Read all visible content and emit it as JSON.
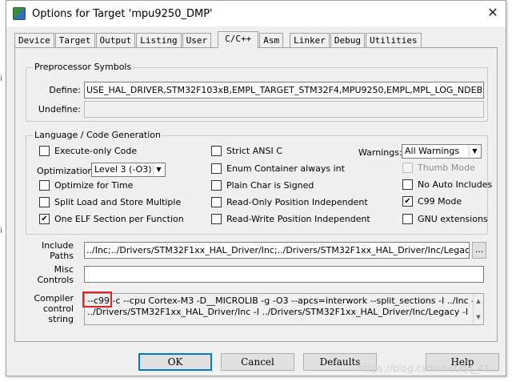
{
  "window": {
    "title": "Options for Target 'mpu9250_DMP'",
    "close_glyph": "✕"
  },
  "tabs": [
    "Device",
    "Target",
    "Output",
    "Listing",
    "User",
    "C/C++",
    "Asm",
    "Linker",
    "Debug",
    "Utilities"
  ],
  "active_tab": "C/C++",
  "preprocessor": {
    "legend": "Preprocessor Symbols",
    "define_label": "Define:",
    "define_value": "USE_HAL_DRIVER,STM32F103xB,EMPL_TARGET_STM32F4,MPU9250,EMPL,MPL_LOG_NDEBUG=",
    "undefine_label": "Undefine:",
    "undefine_value": ""
  },
  "language": {
    "legend": "Language / Code Generation",
    "execute_only": {
      "label": "Execute-only Code",
      "checked": false
    },
    "optimization_label": "Optimization:",
    "optimization_value": "Level 3 (-O3)",
    "optimize_time": {
      "label": "Optimize for Time",
      "checked": false
    },
    "split_load": {
      "label": "Split Load and Store Multiple",
      "checked": false
    },
    "one_elf": {
      "label": "One ELF Section per Function",
      "checked": true
    },
    "strict_ansi": {
      "label": "Strict ANSI C",
      "checked": false
    },
    "enum_container": {
      "label": "Enum Container always int",
      "checked": false
    },
    "plain_char": {
      "label": "Plain Char is Signed",
      "checked": false
    },
    "ro_pos": {
      "label": "Read-Only Position Independent",
      "checked": false
    },
    "rw_pos": {
      "label": "Read-Write Position Independent",
      "checked": false
    },
    "warnings_label": "Warnings:",
    "warnings_value": "All Warnings",
    "thumb_mode": {
      "label": "Thumb Mode",
      "checked": false
    },
    "no_auto_includes": {
      "label": "No Auto Includes",
      "checked": false
    },
    "c99_mode": {
      "label": "C99 Mode",
      "checked": true
    },
    "gnu_extensions": {
      "label": "GNU extensions",
      "checked": false
    }
  },
  "include": {
    "label_line1": "Include",
    "label_line2": "Paths",
    "value": "../Inc;../Drivers/STM32F1xx_HAL_Driver/Inc;../Drivers/STM32F1xx_HAL_Driver/Inc/Legacy;../Driv",
    "browse_label": "..."
  },
  "misc": {
    "label_line1": "Misc",
    "label_line2": "Controls",
    "value": ""
  },
  "compiler": {
    "label_line1": "Compiler",
    "label_line2": "control",
    "label_line3": "string",
    "line1": "--c99 -c --cpu Cortex-M3 -D__MICROLIB -g -O3 --apcs=interwork --split_sections -I ../Inc -I",
    "line2": "../Drivers/STM32F1xx_HAL_Driver/Inc -I ../Drivers/STM32F1xx_HAL_Driver/Inc/Legacy -I"
  },
  "buttons": {
    "ok": "OK",
    "cancel": "Cancel",
    "defaults": "Defaults",
    "help": "Help"
  },
  "watermark": "https://blog.csdn.net/qq_41..."
}
